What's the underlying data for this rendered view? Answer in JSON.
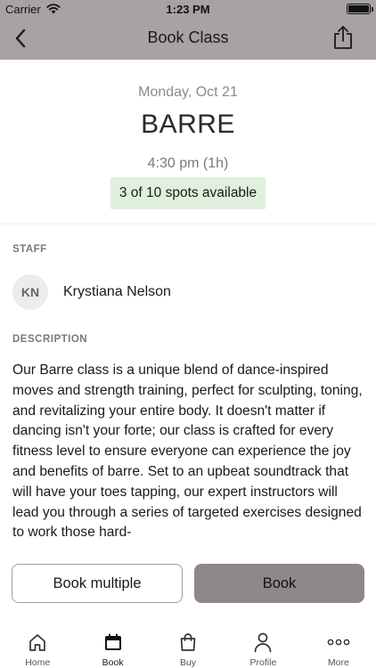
{
  "status_bar": {
    "carrier": "Carrier",
    "time": "1:23 PM"
  },
  "nav": {
    "title": "Book Class"
  },
  "class_info": {
    "date": "Monday, Oct 21",
    "name": "BARRE",
    "duration": "4:30 pm (1h)",
    "spots": "3 of 10 spots available"
  },
  "staff": {
    "label": "STAFF",
    "initials": "KN",
    "name": "Krystiana Nelson"
  },
  "description": {
    "label": "DESCRIPTION",
    "text": "Our Barre class is a unique blend of dance-inspired moves and strength training, perfect for sculpting, toning, and revitalizing your entire body. It doesn't matter if dancing isn't your forte; our class is crafted for every fitness level to ensure everyone can experience the joy and benefits of barre. Set to an upbeat soundtrack that will have your toes tapping, our expert instructors will lead you through a series of targeted exercises designed to work those hard-"
  },
  "actions": {
    "book_multiple": "Book multiple",
    "book": "Book"
  },
  "tabs": [
    {
      "label": "Home",
      "icon": "home-icon"
    },
    {
      "label": "Book",
      "icon": "calendar-icon"
    },
    {
      "label": "Buy",
      "icon": "shopping-bag-icon"
    },
    {
      "label": "Profile",
      "icon": "person-icon"
    },
    {
      "label": "More",
      "icon": "more-dots-icon"
    }
  ],
  "colors": {
    "header_bg": "#a8a3a3",
    "spots_bg": "#dff0dc",
    "primary_button": "#8f8888"
  }
}
